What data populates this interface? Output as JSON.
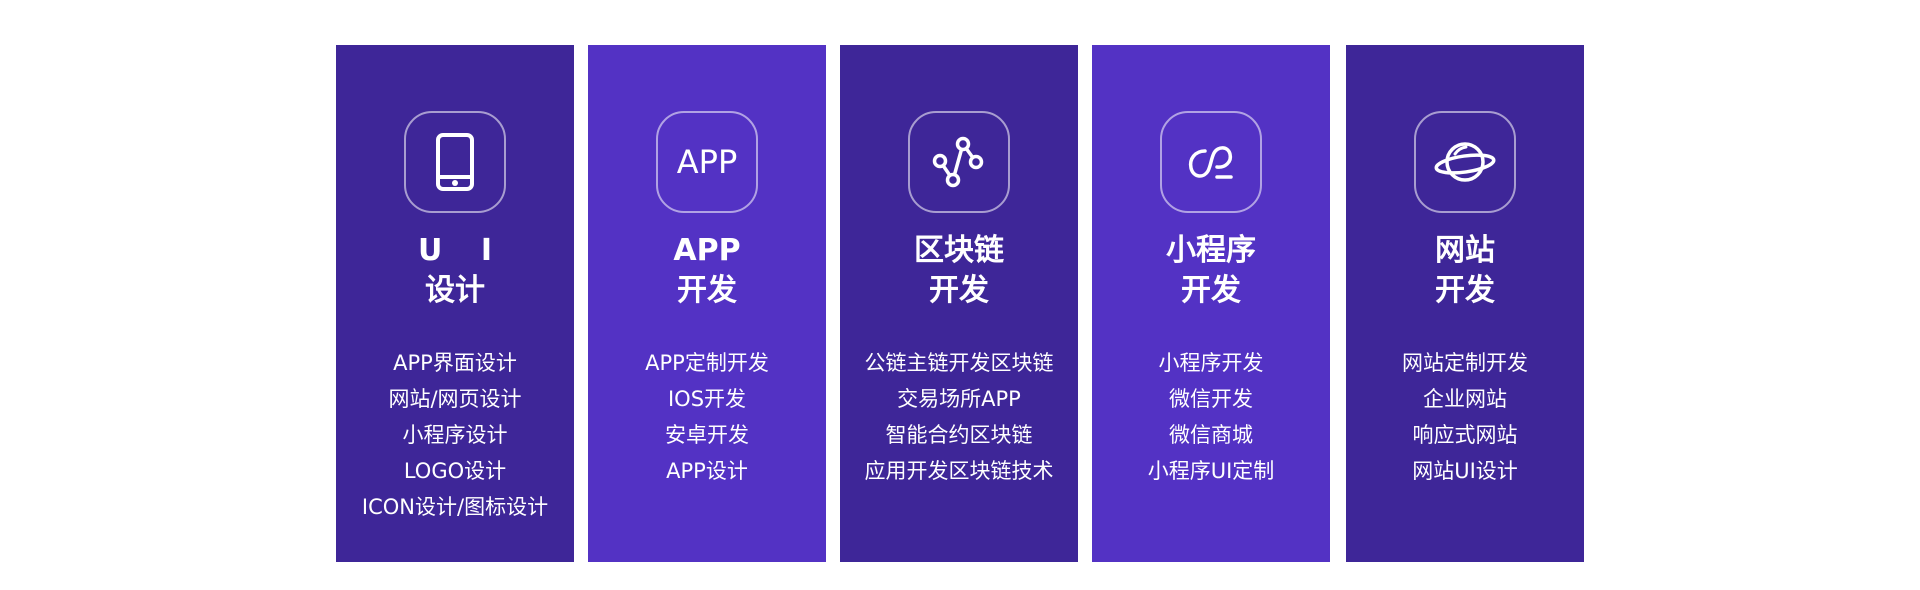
{
  "colors": {
    "card_dark": "#3e2698",
    "card_light": "#5332c4",
    "text": "#ffffff",
    "icon_border": "rgba(255,255,255,0.55)"
  },
  "cards": [
    {
      "icon": "smartphone-icon",
      "title_line1": "U I",
      "title_line2": "设计",
      "items": [
        "APP界面设计",
        "网站/网页设计",
        "小程序设计",
        "LOGO设计",
        "ICON设计/图标设计"
      ]
    },
    {
      "icon": "app-text-icon",
      "icon_text": "APP",
      "title_line1": "APP",
      "title_line2": "开发",
      "items": [
        "APP定制开发",
        "IOS开发",
        "安卓开发",
        "APP设计"
      ]
    },
    {
      "icon": "network-nodes-icon",
      "title_line1": "区块链",
      "title_line2": "开发",
      "items": [
        "公链主链开发区块链",
        "交易场所APP",
        "智能合约区块链",
        "应用开发区块链技术"
      ]
    },
    {
      "icon": "mini-program-icon",
      "title_line1": "小程序",
      "title_line2": "开发",
      "items": [
        "小程序开发",
        "微信开发",
        "微信商城",
        "小程序UI定制"
      ]
    },
    {
      "icon": "planet-icon",
      "title_line1": "网站",
      "title_line2": "开发",
      "items": [
        "网站定制开发",
        "企业网站",
        "响应式网站",
        "网站UI设计"
      ]
    }
  ]
}
